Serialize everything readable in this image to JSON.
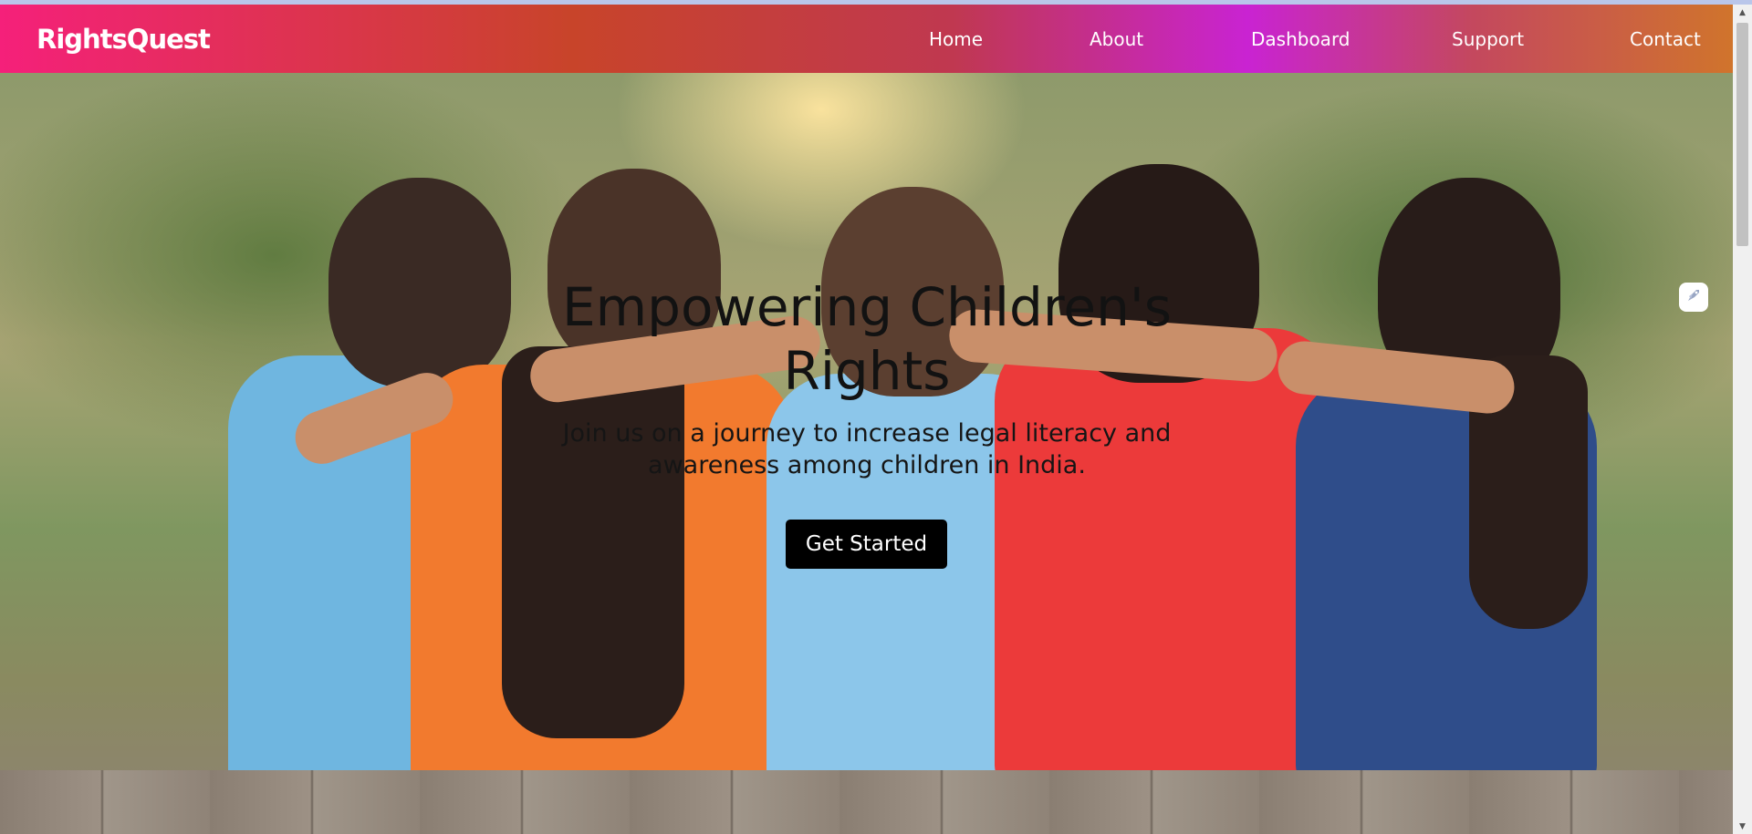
{
  "brand": {
    "name": "RightsQuest"
  },
  "nav": {
    "items": [
      {
        "label": "Home"
      },
      {
        "label": "About"
      },
      {
        "label": "Dashboard"
      },
      {
        "label": "Support"
      },
      {
        "label": "Contact"
      }
    ]
  },
  "hero": {
    "title": "Empowering Children's Rights",
    "subtitle": "Join us on a journey to increase legal literacy and awareness among children in India.",
    "cta_label": "Get Started",
    "image_semantic": "five-children-sitting-arm-in-arm-photo"
  },
  "widget": {
    "icon": "rocket-icon"
  },
  "colors": {
    "nav_gradient": [
      "#f5207a",
      "#c8442a",
      "#c923d2",
      "#d0742c"
    ],
    "cta_background": "#000000",
    "cta_text": "#ffffff",
    "nav_text": "#ffffff"
  }
}
